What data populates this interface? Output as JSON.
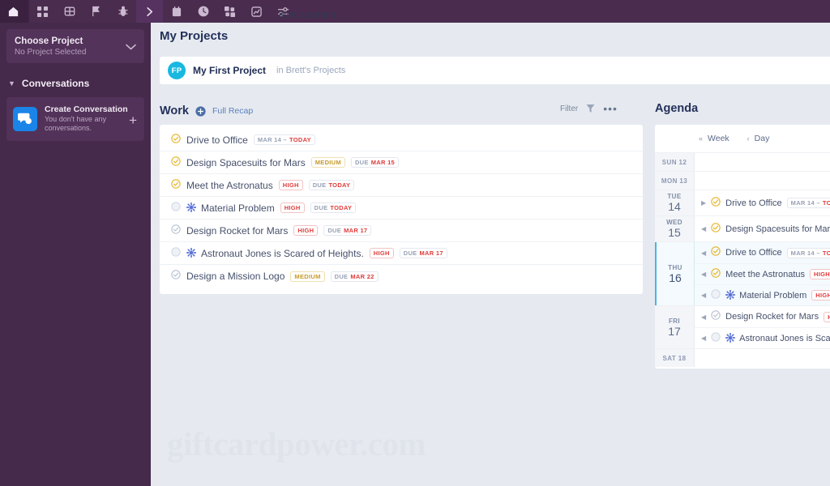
{
  "topbar": {
    "icons": [
      {
        "name": "home-icon",
        "label": "Home"
      },
      {
        "name": "grid-icon",
        "label": "Dashboard"
      },
      {
        "name": "board-icon",
        "label": "Board"
      },
      {
        "name": "flag-icon",
        "label": "Milestones"
      },
      {
        "name": "bug-icon",
        "label": "Issues"
      },
      {
        "name": "chevron-right-icon",
        "label": "Expand"
      },
      {
        "name": "calendar-icon",
        "label": "Calendar"
      },
      {
        "name": "clock-icon",
        "label": "Time"
      },
      {
        "name": "apps-icon",
        "label": "Apps"
      },
      {
        "name": "chart-icon",
        "label": "Reports"
      },
      {
        "name": "sliders-icon",
        "label": "Settings"
      }
    ],
    "fragment_text": "ever a person."
  },
  "sidebar": {
    "project_picker": {
      "title": "Choose Project",
      "subtitle": "No Project Selected",
      "chevron": "chevron-down-icon"
    },
    "conversations": {
      "section_label": "Conversations",
      "caret": "caret-down-icon",
      "card": {
        "title": "Create Conversation",
        "subtitle": "You don't have any conversations.",
        "avatar_icon": "chat-bubble-icon",
        "add_label": "+"
      }
    }
  },
  "main": {
    "page_title": "My Projects",
    "watermark": "giftcardpower.com",
    "project": {
      "avatar_initials": "FP",
      "name": "My First Project",
      "location_prefix": "in",
      "location": "Brett's Projects"
    },
    "work": {
      "title": "Work",
      "add_icon": "plus-circle-icon",
      "full_recap_label": "Full Recap",
      "filter_label": "Filter",
      "filter_icon": "funnel-icon",
      "more_label": "•••",
      "tasks": [
        {
          "name": "Drive to Office",
          "check": "yellow",
          "is_issue": false,
          "badges": [
            {
              "type": "date-range",
              "muted": "MAR 14 –",
              "hot": "TODAY"
            }
          ]
        },
        {
          "name": "Design Spacesuits for Mars",
          "check": "yellow",
          "is_issue": false,
          "badges": [
            {
              "type": "priority",
              "level": "medium",
              "text": "MEDIUM"
            },
            {
              "type": "due",
              "muted": "DUE",
              "hot": "MAR 15"
            }
          ]
        },
        {
          "name": "Meet the Astronatus",
          "check": "yellow",
          "is_issue": false,
          "badges": [
            {
              "type": "priority",
              "level": "high",
              "text": "HIGH"
            },
            {
              "type": "due",
              "muted": "DUE",
              "hot": "TODAY"
            }
          ]
        },
        {
          "name": "Material Problem",
          "check": "empty",
          "is_issue": true,
          "badges": [
            {
              "type": "priority",
              "level": "high",
              "text": "HIGH"
            },
            {
              "type": "due",
              "muted": "DUE",
              "hot": "TODAY"
            }
          ]
        },
        {
          "name": "Design Rocket for Mars",
          "check": "gray",
          "is_issue": false,
          "badges": [
            {
              "type": "priority",
              "level": "high",
              "text": "HIGH"
            },
            {
              "type": "due",
              "muted": "DUE",
              "hot": "MAR 17"
            }
          ]
        },
        {
          "name": "Astronaut Jones is Scared of Heights.",
          "check": "empty",
          "is_issue": true,
          "badges": [
            {
              "type": "priority",
              "level": "high",
              "text": "HIGH"
            },
            {
              "type": "due",
              "muted": "DUE",
              "hot": "MAR 17"
            }
          ]
        },
        {
          "name": "Design a Mission Logo",
          "check": "gray",
          "is_issue": false,
          "badges": [
            {
              "type": "priority",
              "level": "medium",
              "text": "MEDIUM"
            },
            {
              "type": "due",
              "muted": "DUE",
              "hot": "MAR 22"
            }
          ]
        }
      ]
    },
    "agenda": {
      "title": "Agenda",
      "nav": [
        {
          "arrow": "«",
          "label": "Week",
          "name": "week-nav"
        },
        {
          "arrow": "‹",
          "label": "Day",
          "name": "day-nav"
        }
      ],
      "days": [
        {
          "compact": "SUN 12",
          "dow": "SUN",
          "num": "12",
          "today": false,
          "events": []
        },
        {
          "compact": "MON 13",
          "dow": "MON",
          "num": "13",
          "today": false,
          "events": []
        },
        {
          "compact": "TUE 14",
          "dow": "TUE",
          "num": "14",
          "today": false,
          "events": [
            {
              "arrow": "▶",
              "check": "yellow",
              "is_issue": false,
              "name": "Drive to Office",
              "badges": [
                {
                  "type": "date-range",
                  "muted": "MAR 14 –",
                  "hot": "TODA"
                }
              ]
            }
          ]
        },
        {
          "compact": "WED 15",
          "dow": "WED",
          "num": "15",
          "today": false,
          "events": [
            {
              "arrow": "◀",
              "check": "yellow",
              "is_issue": false,
              "name": "Design Spacesuits for Mars",
              "badges": []
            }
          ]
        },
        {
          "compact": "THU 16",
          "dow": "THU",
          "num": "16",
          "today": true,
          "events": [
            {
              "arrow": "◀",
              "check": "yellow",
              "is_issue": false,
              "name": "Drive to Office",
              "badges": [
                {
                  "type": "date-range",
                  "muted": "MAR 14 –",
                  "hot": "TODA"
                }
              ]
            },
            {
              "arrow": "◀",
              "check": "yellow",
              "is_issue": false,
              "name": "Meet the Astronatus",
              "badges": [
                {
                  "type": "priority",
                  "level": "high",
                  "text": "HIGH"
                }
              ]
            },
            {
              "arrow": "◀",
              "check": "empty",
              "is_issue": true,
              "name": "Material Problem",
              "badges": [
                {
                  "type": "priority",
                  "level": "high",
                  "text": "HIGH"
                }
              ]
            }
          ]
        },
        {
          "compact": "FRI 17",
          "dow": "FRI",
          "num": "17",
          "today": false,
          "events": [
            {
              "arrow": "◀",
              "check": "gray",
              "is_issue": false,
              "name": "Design Rocket for Mars",
              "badges": [
                {
                  "type": "priority",
                  "level": "high",
                  "text": "HIG"
                }
              ]
            },
            {
              "arrow": "◀",
              "check": "empty",
              "is_issue": true,
              "name": "Astronaut Jones is Scared",
              "badges": []
            }
          ]
        },
        {
          "compact": "SAT 18",
          "dow": "SAT",
          "num": "18",
          "today": false,
          "events": []
        }
      ]
    }
  },
  "colors": {
    "sidebar_bg": "#452a4b",
    "topbar_bg": "#4a2c4f",
    "canvas_bg": "#e6eaf0",
    "accent_blue": "#1a84e8",
    "project_avatar": "#18b8e0",
    "check_yellow": "#e8b427",
    "check_gray": "#b9c2d2",
    "hot_red": "#e03b3b",
    "medium_amber": "#c79a2a",
    "today_band": "#49b6e0"
  }
}
